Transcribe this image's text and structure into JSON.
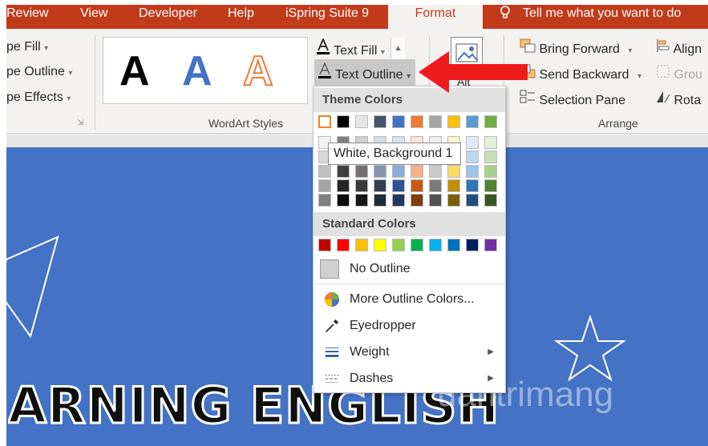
{
  "tabs": [
    {
      "label": "Review"
    },
    {
      "label": "View"
    },
    {
      "label": "Developer"
    },
    {
      "label": "Help"
    },
    {
      "label": "iSpring Suite 9"
    },
    {
      "label": "Format"
    }
  ],
  "tell_me": "Tell me what you want to do",
  "shape_styles": {
    "fill": "pe Fill",
    "outline": "pe Outline",
    "effects": "pe Effects"
  },
  "wordart": {
    "group_label": "WordArt Styles",
    "letters": [
      "A",
      "A",
      "A"
    ],
    "text_fill": "Text Fill",
    "text_outline": "Text Outline",
    "text_effects": "A"
  },
  "arrange": {
    "bring_forward": "Bring Forward",
    "send_backward": "Send Backward",
    "selection_pane": "Selection Pane",
    "align": "Align",
    "group": "Grou",
    "rotate": "Rota",
    "group_label": "Arrange"
  },
  "alt_text_label": "Alt",
  "menu": {
    "theme_header": "Theme Colors",
    "standard_header": "Standard Colors",
    "no_outline": "No Outline",
    "more_colors": "More Outline Colors...",
    "eyedropper": "Eyedropper",
    "weight": "Weight",
    "dashes": "Dashes",
    "theme_top": [
      "#ffffff",
      "#000000",
      "#e7e6e6",
      "#44546a",
      "#4472c4",
      "#ed7d31",
      "#a5a5a5",
      "#ffc000",
      "#5b9bd5",
      "#70ad47"
    ],
    "theme_shades": [
      [
        "#f2f2f2",
        "#808080",
        "#d0cece",
        "#d6dce4",
        "#d9e2f3",
        "#fbe5d5",
        "#ededed",
        "#fff2cc",
        "#deebf6",
        "#e2efd9"
      ],
      [
        "#d8d8d8",
        "#595959",
        "#aeabab",
        "#adb9ca",
        "#b4c6e7",
        "#f7cbac",
        "#dbdbdb",
        "#fee599",
        "#bdd7ee",
        "#c5e0b3"
      ],
      [
        "#bfbfbf",
        "#3f3f3f",
        "#757070",
        "#8496b0",
        "#8eaadb",
        "#f4b183",
        "#c9c9c9",
        "#ffd965",
        "#9cc3e5",
        "#a8d08d"
      ],
      [
        "#a5a5a5",
        "#262626",
        "#3a3838",
        "#323f4f",
        "#2f5496",
        "#c55a11",
        "#7b7b7b",
        "#bf9000",
        "#2e75b5",
        "#538135"
      ],
      [
        "#7f7f7f",
        "#0c0c0c",
        "#171616",
        "#222a35",
        "#1f3864",
        "#833c0b",
        "#525252",
        "#7f6000",
        "#1e4e79",
        "#375623"
      ]
    ],
    "standard": [
      "#c00000",
      "#ff0000",
      "#ffc000",
      "#ffff00",
      "#92d050",
      "#00b050",
      "#00b0f0",
      "#0070c0",
      "#002060",
      "#7030a0"
    ]
  },
  "tooltip": "White, Background 1",
  "slide": {
    "headline": "ARNING ENGLISH",
    "watermark": "uantrimang"
  }
}
